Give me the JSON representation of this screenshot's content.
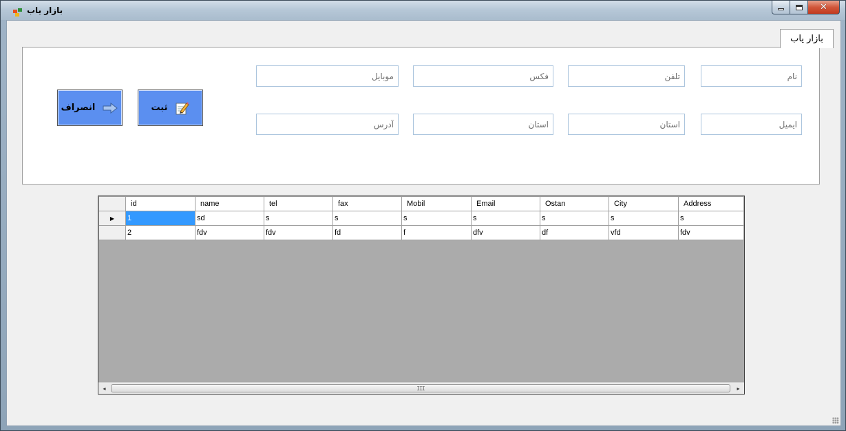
{
  "window": {
    "title": "بازار یاب",
    "close_glyph": "✕"
  },
  "tab": {
    "label": "بازار یاب"
  },
  "form": {
    "fields": {
      "name": "نام",
      "phone": "تلفن",
      "fax": "فکس",
      "mobile": "موبایل",
      "email": "ایمیل",
      "province": "استان",
      "city": "استان",
      "address": "آدرس"
    },
    "buttons": {
      "submit": "ثبت",
      "cancel": "انصراف"
    }
  },
  "grid": {
    "columns": [
      "id",
      "name",
      "tel",
      "fax",
      "Mobil",
      "Email",
      "Ostan",
      "City",
      "Address"
    ],
    "current_row_indicator": "▶",
    "rows": [
      [
        "1",
        "sd",
        "s",
        "s",
        "s",
        "s",
        "s",
        "s",
        "s"
      ],
      [
        "2",
        "fdv",
        "fdv",
        "fd",
        "f",
        "dfv",
        "df",
        "vfd",
        "fdv"
      ]
    ],
    "scroll": {
      "left_arrow": "◂",
      "right_arrow": "▸",
      "thumb_grip": "III"
    }
  },
  "colors": {
    "button_blue": "#5b8ff0",
    "selected_cell": "#3399ff",
    "grid_background": "#ababab"
  }
}
